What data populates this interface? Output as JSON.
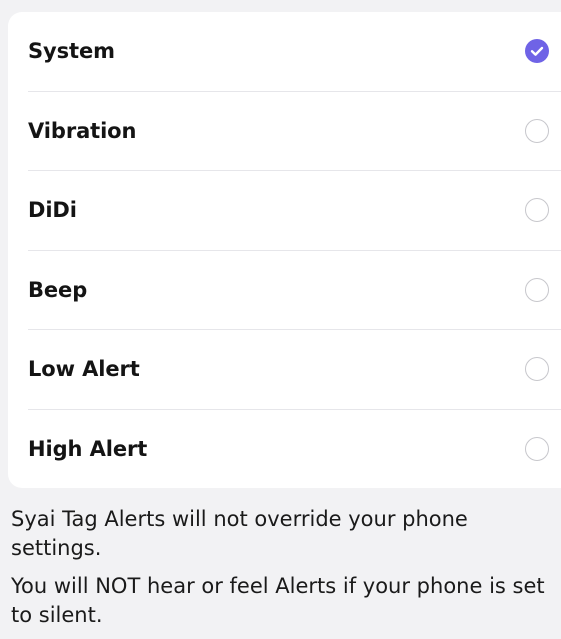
{
  "alert_options": {
    "items": [
      {
        "label": "System",
        "selected": true
      },
      {
        "label": "Vibration",
        "selected": false
      },
      {
        "label": "DiDi",
        "selected": false
      },
      {
        "label": "Beep",
        "selected": false
      },
      {
        "label": "Low Alert",
        "selected": false
      },
      {
        "label": "High Alert",
        "selected": false
      }
    ]
  },
  "notes": {
    "line1": "Syai Tag Alerts will not override your phone settings.",
    "line2": "You will NOT hear or feel Alerts if your phone is set to silent."
  },
  "colors": {
    "accent": "#6F63E6",
    "background": "#F2F2F4",
    "card": "#FFFFFF"
  }
}
